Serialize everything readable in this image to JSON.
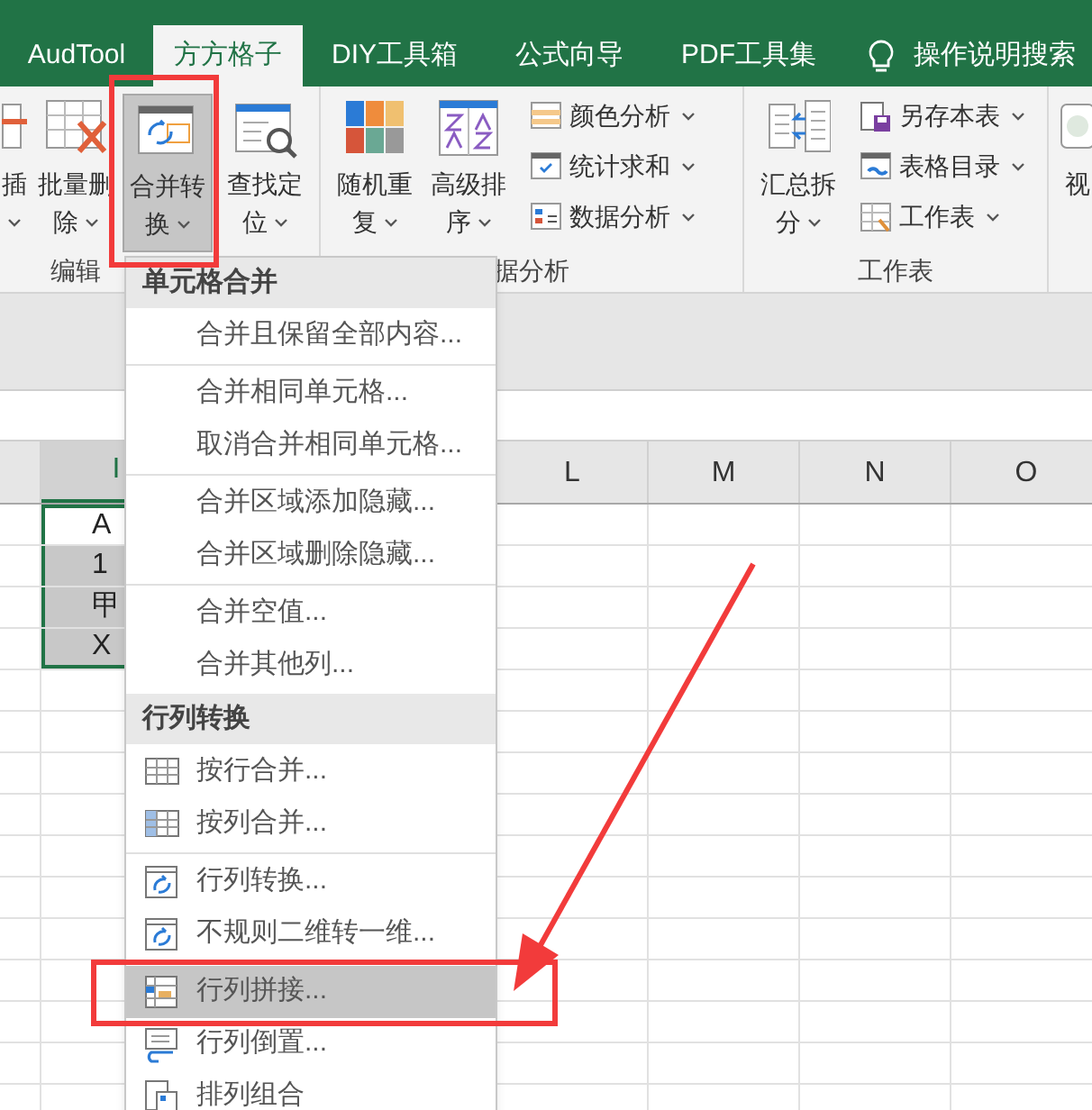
{
  "tabs": [
    {
      "label": "AudTool",
      "selected": false
    },
    {
      "label": "方方格子",
      "selected": true
    },
    {
      "label": "DIY工具箱",
      "selected": false
    },
    {
      "label": "公式向导",
      "selected": false
    },
    {
      "label": "PDF工具集",
      "selected": false
    }
  ],
  "search": {
    "label": "操作说明搜索"
  },
  "ribbon": {
    "groups": [
      {
        "label": "编辑",
        "large_buttons": [
          {
            "kind": "insert",
            "lines": [
              "插"
            ],
            "selected": false
          },
          {
            "kind": "delete",
            "lines": [
              "批量删",
              "除"
            ],
            "selected": false
          },
          {
            "kind": "merge",
            "lines": [
              "合并转",
              "换"
            ],
            "selected": true
          },
          {
            "kind": "find",
            "lines": [
              "查找定",
              "位"
            ],
            "selected": false
          }
        ]
      },
      {
        "label": "据分析",
        "large_buttons": [
          {
            "kind": "random",
            "lines": [
              "随机重",
              "复"
            ],
            "selected": false
          },
          {
            "kind": "sort",
            "lines": [
              "高级排",
              "序"
            ],
            "selected": false
          }
        ],
        "small_buttons": [
          {
            "kind": "color",
            "label": "颜色分析"
          },
          {
            "kind": "stats",
            "label": "统计求和"
          },
          {
            "kind": "analysis",
            "label": "数据分析"
          }
        ]
      },
      {
        "label": "工作表",
        "large_buttons": [
          {
            "kind": "summary",
            "lines": [
              "汇总拆",
              "分"
            ],
            "selected": false
          }
        ],
        "small_buttons": [
          {
            "kind": "save",
            "label": "另存本表"
          },
          {
            "kind": "catalog",
            "label": "表格目录"
          },
          {
            "kind": "sheet",
            "label": "工作表"
          }
        ]
      },
      {
        "large_buttons": [
          {
            "kind": "view",
            "lines": [
              "视"
            ],
            "selected": false
          }
        ]
      }
    ]
  },
  "sheet": {
    "columns": [
      {
        "label": "I",
        "selected": true
      },
      {
        "label": "L",
        "selected": false
      },
      {
        "label": "M",
        "selected": false
      },
      {
        "label": "N",
        "selected": false
      },
      {
        "label": "O",
        "selected": false
      }
    ],
    "cells": [
      {
        "text": "A",
        "selected": false
      },
      {
        "text": "1",
        "selected": true
      },
      {
        "text": "甲",
        "selected": true
      },
      {
        "text": "X",
        "selected": true
      }
    ]
  },
  "menu": {
    "sections": [
      {
        "title": "单元格合并",
        "groups": [
          [
            {
              "label": "合并且保留全部内容...",
              "kind": "plain",
              "selected": false
            }
          ],
          [
            {
              "label": "合并相同单元格...",
              "kind": "plain",
              "selected": false
            },
            {
              "label": "取消合并相同单元格...",
              "kind": "plain",
              "selected": false
            }
          ],
          [
            {
              "label": "合并区域添加隐藏...",
              "kind": "plain",
              "selected": false
            },
            {
              "label": "合并区域删除隐藏...",
              "kind": "plain",
              "selected": false
            }
          ],
          [
            {
              "label": "合并空值...",
              "kind": "plain",
              "selected": false
            },
            {
              "label": "合并其他列...",
              "kind": "plain",
              "selected": false
            }
          ]
        ]
      },
      {
        "title": "行列转换",
        "groups": [
          [
            {
              "label": "按行合并...",
              "kind": "rows",
              "selected": false
            },
            {
              "label": "按列合并...",
              "kind": "cols",
              "selected": false
            }
          ],
          [
            {
              "label": "行列转换...",
              "kind": "transpose",
              "selected": false
            },
            {
              "label": "不规则二维转一维...",
              "kind": "transpose",
              "selected": false
            }
          ],
          [
            {
              "label": "行列拼接...",
              "kind": "join",
              "selected": true
            },
            {
              "label": "行列倒置...",
              "kind": "reverse",
              "selected": false
            },
            {
              "label": "排列组合",
              "kind": "combo",
              "selected": false
            }
          ]
        ]
      }
    ]
  },
  "annotations": [
    {
      "kind": "box"
    },
    {
      "kind": "box"
    },
    {
      "kind": "arrow"
    }
  ]
}
